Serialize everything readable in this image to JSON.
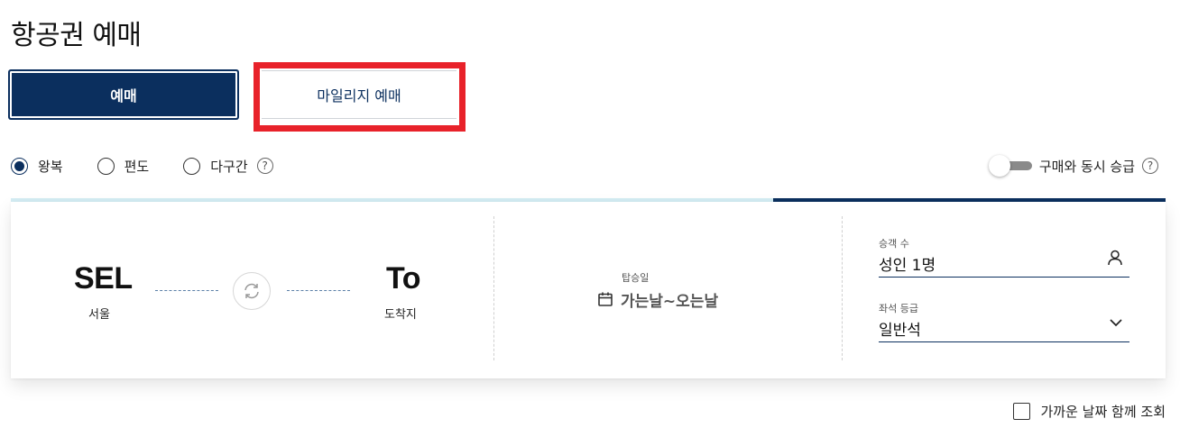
{
  "page_title": "항공권 예매",
  "tabs": [
    {
      "label": "예매",
      "active": true
    },
    {
      "label": "마일리지 예매",
      "active": false
    }
  ],
  "trip_types": [
    {
      "label": "왕복",
      "checked": true
    },
    {
      "label": "편도",
      "checked": false
    },
    {
      "label": "다구간",
      "checked": false
    }
  ],
  "help_glyph": "?",
  "upgrade": {
    "label": "구매와 동시 승급",
    "enabled": false
  },
  "route": {
    "origin_code": "SEL",
    "origin_city": "서울",
    "destination_code": "To",
    "destination_city": "도착지"
  },
  "date": {
    "label": "탑승일",
    "value": "가는날~오는날"
  },
  "passengers": {
    "label": "승객 수",
    "value": "성인 1명"
  },
  "cabin": {
    "label": "좌석 등급",
    "value": "일반석"
  },
  "nearby_dates": {
    "label": "가까운 날짜 함께 조회",
    "checked": false
  },
  "progress": {
    "fraction": 0.34
  },
  "colors": {
    "primary": "#0b2f5e",
    "highlight": "#e8222a",
    "progress_track": "#d3ecf3",
    "toggle_track": "#8a8a8a"
  }
}
